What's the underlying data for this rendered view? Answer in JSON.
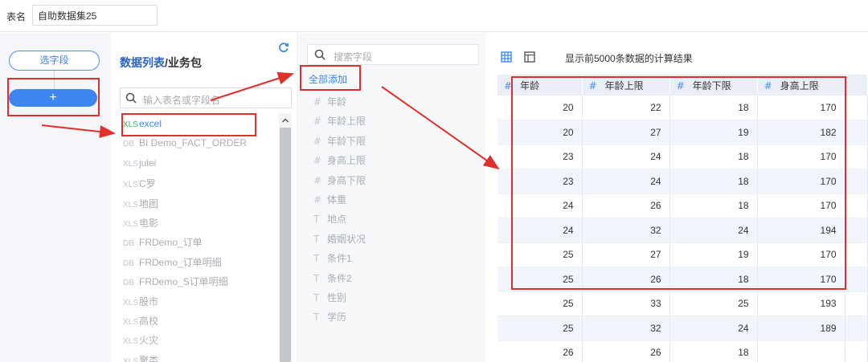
{
  "topbar": {
    "table_label": "表名",
    "table_name_value": "自助数据集25"
  },
  "left": {
    "select_field_label": "选字段",
    "add_label": "+"
  },
  "list_panel": {
    "title_part1": "数据列表",
    "title_sep": "/",
    "title_part2": "业务包",
    "search_placeholder": "输入表名或字段名",
    "tables": [
      {
        "type": "XLS",
        "name": "excel",
        "active": true
      },
      {
        "type": "DB",
        "name": "BI Demo_FACT_ORDER"
      },
      {
        "type": "XLS",
        "name": "julei"
      },
      {
        "type": "XLS",
        "name": "C罗"
      },
      {
        "type": "XLS",
        "name": "地图"
      },
      {
        "type": "XLS",
        "name": "电影"
      },
      {
        "type": "DB",
        "name": "FRDemo_订单"
      },
      {
        "type": "DB",
        "name": "FRDemo_订单明细"
      },
      {
        "type": "DB",
        "name": "FRDemo_S订单明细"
      },
      {
        "type": "XLS",
        "name": "股市"
      },
      {
        "type": "XLS",
        "name": "高校"
      },
      {
        "type": "XLS",
        "name": "火灾"
      },
      {
        "type": "XLS",
        "name": "聚类"
      }
    ]
  },
  "field_panel": {
    "search_placeholder": "搜索字段",
    "add_all_label": "全部添加",
    "fields": [
      {
        "type": "#",
        "name": "年龄"
      },
      {
        "type": "#",
        "name": "年龄上限"
      },
      {
        "type": "#",
        "name": "年龄下限"
      },
      {
        "type": "#",
        "name": "身高上限"
      },
      {
        "type": "#",
        "name": "身高下限"
      },
      {
        "type": "#",
        "name": "体重"
      },
      {
        "type": "T",
        "name": "地点"
      },
      {
        "type": "T",
        "name": "婚姻状况"
      },
      {
        "type": "T",
        "name": "条件1"
      },
      {
        "type": "T",
        "name": "条件2"
      },
      {
        "type": "T",
        "name": "性别"
      },
      {
        "type": "T",
        "name": "学历"
      }
    ]
  },
  "result_panel": {
    "title": "显示前5000条数据的计算结果",
    "columns": [
      "年龄",
      "年龄上限",
      "年龄下限",
      "身高上限"
    ],
    "rows": [
      [
        "20",
        "22",
        "18",
        "170"
      ],
      [
        "20",
        "27",
        "19",
        "182"
      ],
      [
        "23",
        "24",
        "18",
        "170"
      ],
      [
        "23",
        "24",
        "18",
        "170"
      ],
      [
        "24",
        "26",
        "18",
        "170"
      ],
      [
        "24",
        "32",
        "24",
        "194"
      ],
      [
        "25",
        "27",
        "19",
        "170"
      ],
      [
        "25",
        "26",
        "18",
        "170"
      ],
      [
        "25",
        "33",
        "25",
        "193"
      ],
      [
        "25",
        "32",
        "24",
        "189"
      ],
      [
        "26",
        "26",
        "18",
        ""
      ]
    ]
  },
  "colors": {
    "accent": "#3c86f0",
    "annotation_red": "#e0302b",
    "header_bg": "#e9eef7"
  }
}
